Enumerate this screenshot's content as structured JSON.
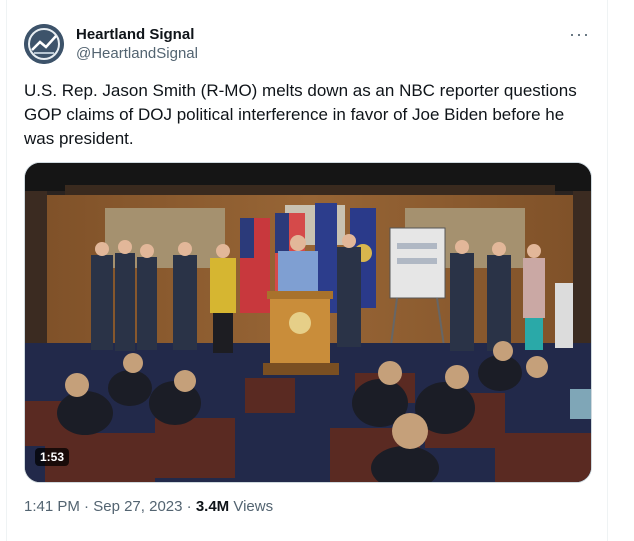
{
  "author": {
    "display_name": "Heartland Signal",
    "handle": "@HeartlandSignal",
    "avatar_icon": "heartland-signal-logo"
  },
  "tweet": {
    "text": "U.S. Rep. Jason Smith (R-MO) melts down as an NBC reporter questions GOP claims of DOJ political interference in favor of Joe Biden before he was president."
  },
  "more_options_icon": "more-dots-icon",
  "video": {
    "duration": "1:53"
  },
  "meta": {
    "time": "1:41 PM",
    "separator": "·",
    "date": "Sep 27, 2023",
    "views_count": "3.4M",
    "views_label": "Views"
  }
}
